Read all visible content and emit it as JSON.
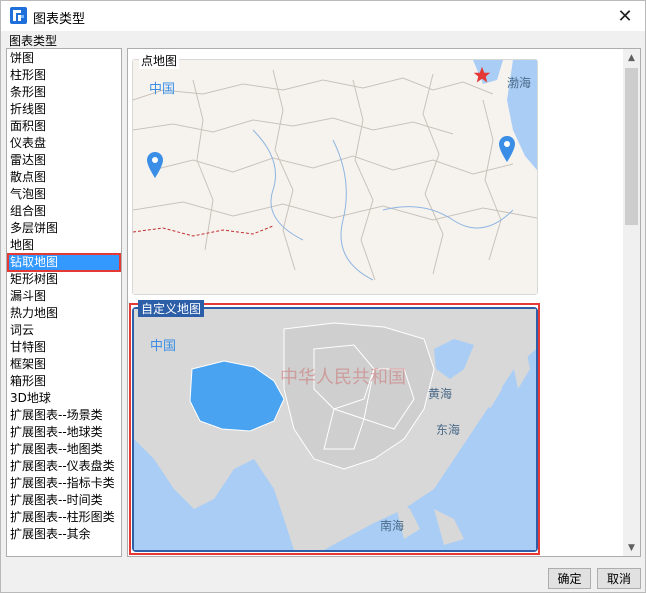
{
  "window": {
    "title": "图表类型",
    "close_glyph": "✕",
    "app_icon": "app-logo-icon"
  },
  "group": {
    "label": "图表类型"
  },
  "chart_types": [
    "饼图",
    "柱形图",
    "条形图",
    "折线图",
    "面积图",
    "仪表盘",
    "雷达图",
    "散点图",
    "气泡图",
    "组合图",
    "多层饼图",
    "地图",
    "钻取地图",
    "矩形树图",
    "漏斗图",
    "热力地图",
    "词云",
    "甘特图",
    "框架图",
    "箱形图",
    "3D地球",
    "扩展图表--场景类",
    "扩展图表--地球类",
    "扩展图表--地图类",
    "扩展图表--仪表盘类",
    "扩展图表--指标卡类",
    "扩展图表--时间类",
    "扩展图表--柱形图类",
    "扩展图表--其余"
  ],
  "selected_type": "钻取地图",
  "previews": [
    {
      "title": "点地图",
      "country_label": "中国",
      "sea_labels": [
        "渤海"
      ],
      "markers": [
        "map-pin-icon",
        "map-pin-icon",
        "star-icon"
      ]
    },
    {
      "title": "自定义地图",
      "country_label": "中国",
      "watermark": "中华人民共和国",
      "sea_labels": [
        "黄海",
        "东海",
        "南海"
      ]
    }
  ],
  "colors": {
    "selection": "#3399ff",
    "highlight_border": "#e53935",
    "card_border": "#2d5fa8",
    "ocean": "#a9cdf5",
    "land": "#d8d8d8",
    "highlight_region": "#4aa3f0"
  },
  "scrollbar": {
    "up_glyph": "▲",
    "down_glyph": "▼"
  },
  "buttons": {
    "ok": "确定",
    "cancel": "取消"
  }
}
